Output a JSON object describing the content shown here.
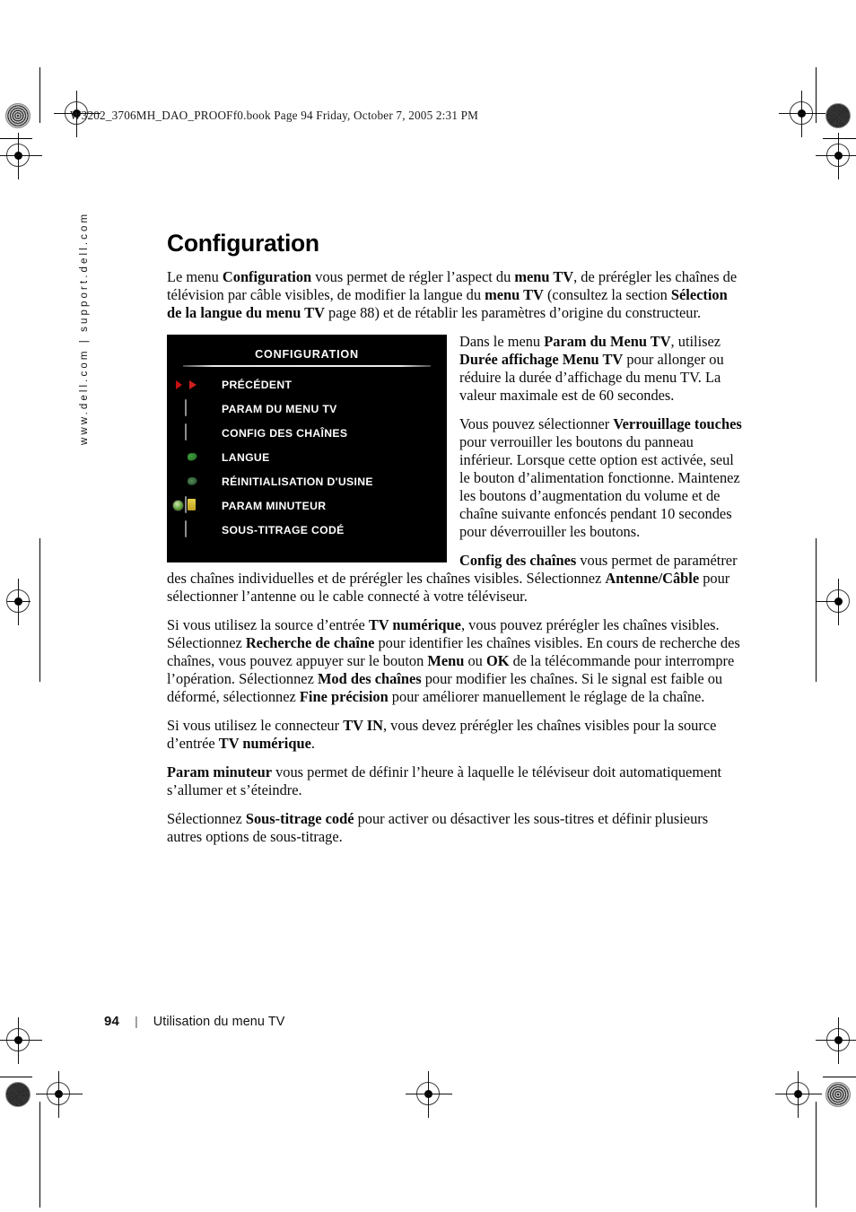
{
  "print_marks": {
    "file_info": "W3202_3706MH_DAO_PROOFf0.book  Page 94  Friday, October 7, 2005  2:31 PM"
  },
  "side_url": "www.dell.com | support.dell.com",
  "page": {
    "title": "Configuration",
    "paragraphs": {
      "intro": {
        "part1": "Le menu ",
        "b1": "Configuration",
        "part2": " vous permet de régler l’aspect du ",
        "b2": "menu TV",
        "part3": ", de prérégler les chaînes de télévision par câble visibles, de modifier la langue du ",
        "b3": "menu TV",
        "part4": " (consultez la section ",
        "b4": "Sélection de la langue du menu TV",
        "part5": " page 88) et de rétablir les paramètres d’origine du constructeur."
      },
      "menu_duration": {
        "part1": "Dans le menu ",
        "b1": "Param du Menu TV",
        "part2": ", utilisez ",
        "b2": "Durée affichage Menu TV",
        "part3": " pour allonger ou réduire la durée d’affichage du menu TV. La valeur maximale est de 60 secondes."
      },
      "key_lock": {
        "part1": "Vous pouvez sélectionner ",
        "b1": "Verrouillage touches",
        "part2": " pour verrouiller les boutons du panneau inférieur. Lorsque cette option est activée, seul le bouton d’alimentation fonctionne. Maintenez les boutons d’augmentation du volume et de chaîne suivante enfoncés pendant 10 secondes pour déverrouiller les boutons."
      },
      "channel_config": {
        "b1": "Config des chaînes",
        "part1": " vous permet de paramétrer des chaînes individuelles et de prérégler les chaînes visibles. Sélectionnez ",
        "b2": "Antenne/Câble",
        "part2": " pour sélectionner l’antenne ou le cable connecté à votre téléviseur."
      },
      "digital_tv": {
        "part1": "Si vous utilisez la source d’entrée ",
        "b1": "TV numérique",
        "part2": ", vous pouvez prérégler les chaînes visibles. Sélectionnez ",
        "b2": "Recherche de chaîne",
        "part3": " pour identifier les chaînes visibles. En cours de recherche des chaînes, vous pouvez appuyer sur le bouton ",
        "b3": "Menu",
        "part4": " ou ",
        "b4": "OK",
        "part5": " de la télécommande pour interrompre l’opération. Sélectionnez ",
        "b5": "Mod des chaînes",
        "part6": " pour modifier les chaînes. Si le signal est faible ou déformé, sélectionnez ",
        "b6": "Fine précision",
        "part7": " pour améliorer manuellement le réglage de la chaîne."
      },
      "tv_in": {
        "part1": "Si vous utilisez le connecteur ",
        "b1": "TV IN",
        "part2": ", vous devez prérégler les chaînes visibles pour la source d’entrée ",
        "b2": "TV numérique",
        "part3": "."
      },
      "timer": {
        "b1": "Param minuteur",
        "part1": " vous permet de définir l’heure à laquelle le téléviseur doit automatiquement s’allumer et s’éteindre."
      },
      "closed_caption": {
        "part1": "Sélectionnez ",
        "b1": "Sous-titrage codé",
        "part2": " pour activer ou désactiver les sous-titres et définir plusieurs autres options de sous-titrage."
      }
    }
  },
  "tv_menu": {
    "title": "CONFIGURATION",
    "cursor_color": "#c51111",
    "background_color": "#000000",
    "text_color": "#ffffff",
    "items": [
      {
        "label": "PRÉCÉDENT",
        "icon": "back-sphere-icon",
        "selected": true
      },
      {
        "label": "PARAM DU MENU TV",
        "icon": "tv-menu-screen-icon",
        "selected": false
      },
      {
        "label": "CONFIG DES CHAÎNES",
        "icon": "channel-screen-icon",
        "selected": false
      },
      {
        "label": "LANGUE",
        "icon": "globe-icon",
        "selected": false
      },
      {
        "label": "RÉINITIALISATION D'USINE",
        "icon": "globe-reset-icon",
        "selected": false
      },
      {
        "label": "PARAM MINUTEUR",
        "icon": "timer-screen-icon",
        "selected": false
      },
      {
        "label": "SOUS-TITRAGE CODÉ",
        "icon": "closed-caption-icon",
        "selected": false
      }
    ]
  },
  "footer": {
    "page_number": "94",
    "separator": "|",
    "section": "Utilisation du menu TV"
  }
}
